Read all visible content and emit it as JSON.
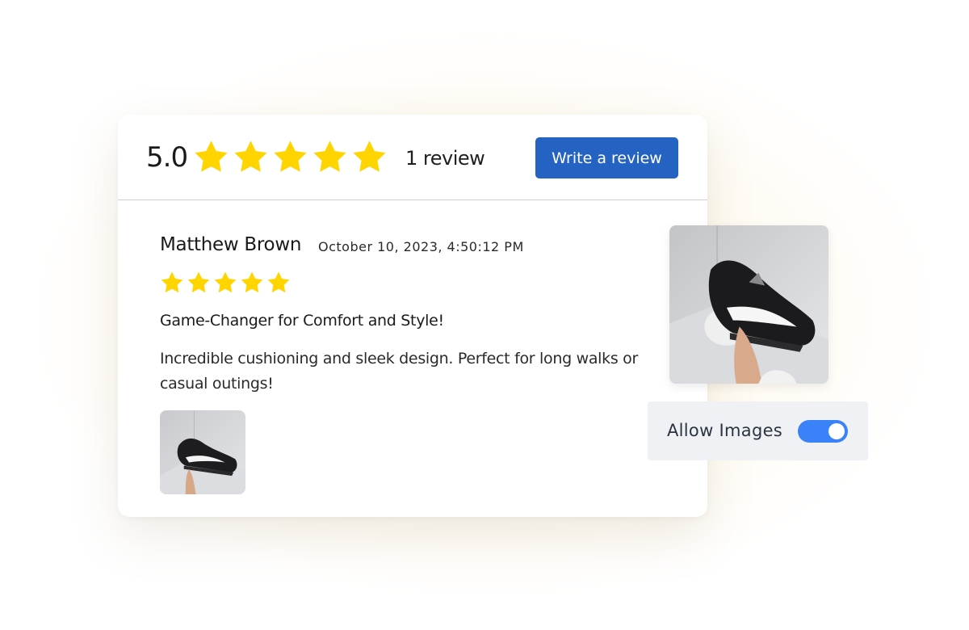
{
  "summary": {
    "average": "5.0",
    "average_stars": 5,
    "review_count": "1 review",
    "write_button": "Write a review"
  },
  "review": {
    "author": "Matthew Brown",
    "date": "October 10, 2023, 4:50:12 PM",
    "rating": 5,
    "title": "Game-Changer for Comfort and Style!",
    "body": "Incredible cushioning and sleek design. Perfect for long walks or casual outings!",
    "photo_icon": "sneaker-photo"
  },
  "settings": {
    "allow_images_label": "Allow Images",
    "allow_images_on": true
  },
  "colors": {
    "star": "#FFD500",
    "button": "#2563C2",
    "toggle_on": "#3A82F7",
    "panel": "#EFF1F4"
  }
}
